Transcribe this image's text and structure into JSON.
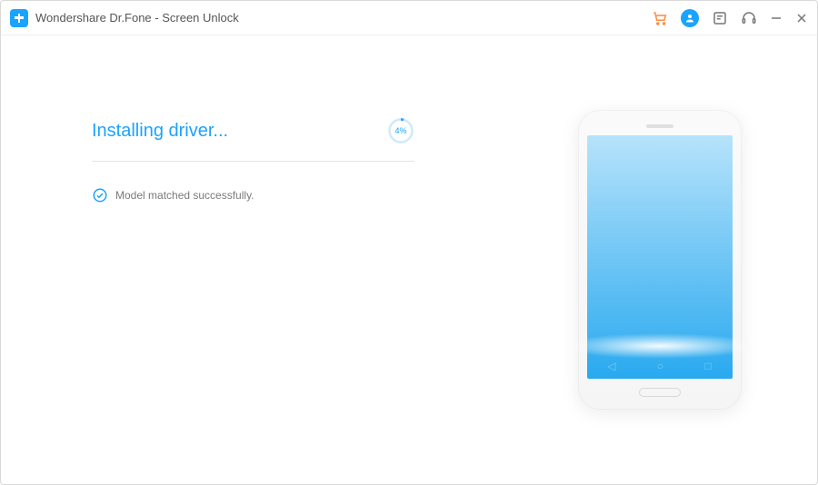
{
  "titlebar": {
    "title": "Wondershare Dr.Fone - Screen Unlock"
  },
  "main": {
    "heading": "Installing driver...",
    "progress_percent": 4,
    "progress_label": "4%",
    "status": "Model matched successfully."
  },
  "colors": {
    "accent": "#1aa3ff"
  }
}
